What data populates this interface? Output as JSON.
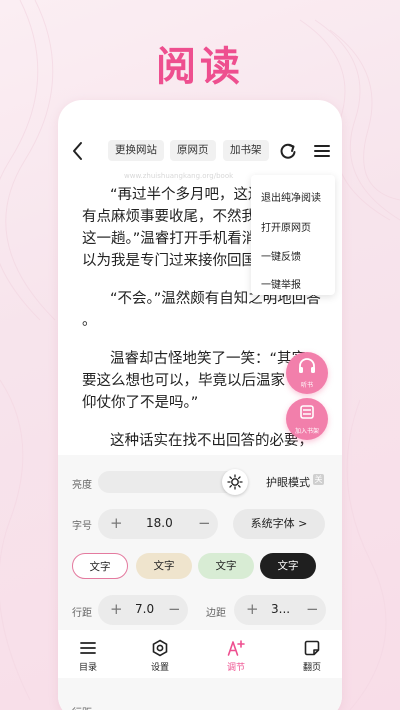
{
  "hero": {
    "title": "阅读"
  },
  "topbar": {
    "buttons": [
      "更换网站",
      "原网页",
      "加书架"
    ]
  },
  "reading": {
    "faint_url": "www.zhuishuangkang.org/book",
    "lines": [
      "“再过半个多月吧，这边还",
      "有点麻烦事要收尾，不然我",
      "这一趟。”温睿打开手机看消",
      "以为我是专门过来接你回国",
      "“不会。”温然颇有自知之明地回答",
      "。",
      "温睿却古怪地笑了一笑：“其实",
      "要这么想也可以，毕竟以后温家",
      "仰仗你了不是吗。”",
      "这种话实在找不出回答的必要，"
    ]
  },
  "menu": {
    "items": [
      "退出纯净阅读",
      "打开原网页",
      "一键反馈",
      "一键举报"
    ]
  },
  "floating": {
    "listen_label": "听书",
    "shelf_label": "加入书架"
  },
  "settings": {
    "brightness_label": "亮度",
    "eye_mode_label": "护眼模式",
    "eye_toggle_symbol": "关",
    "font_size_label": "字号",
    "font_size_value": "18.0",
    "font_family_label": "系统字体 >",
    "swatches": [
      {
        "label": "文字",
        "bg": "#ffffff",
        "fg": "#222222",
        "border": "#e47a9f"
      },
      {
        "label": "文字",
        "bg": "#efe4cd",
        "fg": "#222222",
        "border": "#efe4cd"
      },
      {
        "label": "文字",
        "bg": "#d8ecd4",
        "fg": "#222222",
        "border": "#d8ecd4"
      },
      {
        "label": "文字",
        "bg": "#1f1f1f",
        "fg": "#ffffff",
        "border": "#1f1f1f"
      }
    ],
    "line_spacing_label": "行距",
    "line_spacing_value": "7.0",
    "margin_label": "边距",
    "margin_value": "3..."
  },
  "tabbar": {
    "tabs": [
      {
        "label": "目录",
        "icon": "list-icon"
      },
      {
        "label": "设置",
        "icon": "hexagon-settings-icon"
      },
      {
        "label": "调节",
        "icon": "text-adjust-icon",
        "active": true
      },
      {
        "label": "翻页",
        "icon": "page-turn-icon"
      }
    ]
  },
  "colors": {
    "accent": "#ee4f8f",
    "accent_soft": "#f27fab"
  }
}
